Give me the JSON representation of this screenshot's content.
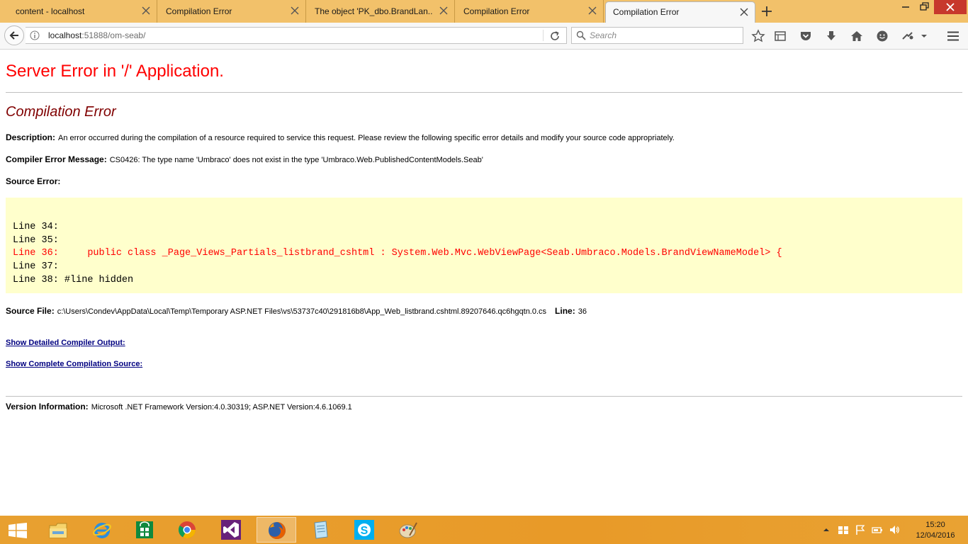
{
  "browser": {
    "tabs": [
      {
        "title": "content - localhost"
      },
      {
        "title": "Compilation Error"
      },
      {
        "title": "The object 'PK_dbo.BrandLan..."
      },
      {
        "title": "Compilation Error"
      },
      {
        "title": "Compilation Error",
        "active": true
      }
    ],
    "url_host": "localhost",
    "url_rest": ":51888/om-seab/",
    "search_placeholder": "Search"
  },
  "page": {
    "server_error_title": "Server Error in '/' Application.",
    "error_type": "Compilation Error",
    "description_label": "Description:",
    "description_text": "An error occurred during the compilation of a resource required to service this request. Please review the following specific error details and modify your source code appropriately.",
    "compiler_message_label": "Compiler Error Message:",
    "compiler_message_text": "CS0426: The type name 'Umbraco' does not exist in the type 'Umbraco.Web.PublishedContentModels.Seab'",
    "source_error_label": "Source Error:",
    "source_lines": [
      {
        "text": "Line 34:",
        "highlight": false
      },
      {
        "text": "Line 35:",
        "highlight": false
      },
      {
        "text": "Line 36:     public class _Page_Views_Partials_listbrand_cshtml : System.Web.Mvc.WebViewPage<Seab.Umbraco.Models.BrandViewNameModel> {",
        "highlight": true
      },
      {
        "text": "Line 37:",
        "highlight": false
      },
      {
        "text": "Line 38: #line hidden",
        "highlight": false
      }
    ],
    "source_file_label": "Source File:",
    "source_file_path": "c:\\Users\\Condev\\AppData\\Local\\Temp\\Temporary ASP.NET Files\\vs\\53737c40\\291816b8\\App_Web_listbrand.cshtml.89207646.qc6hgqtn.0.cs",
    "line_label": "Line:",
    "line_number": "36",
    "link_compiler_output": "Show Detailed Compiler Output:",
    "link_compilation_source": "Show Complete Compilation Source:",
    "version_label": "Version Information:",
    "version_text": "Microsoft .NET Framework Version:4.0.30319; ASP.NET Version:4.6.1069.1"
  },
  "taskbar": {
    "apps": [
      "start-icon",
      "file-explorer-icon",
      "internet-explorer-icon",
      "store-icon",
      "chrome-icon",
      "visual-studio-icon",
      "firefox-icon",
      "notepad-icon",
      "skype-icon",
      "paint-icon"
    ],
    "active_app": "firefox-icon",
    "time": "15:20",
    "date": "12/04/2016"
  },
  "colors": {
    "tabstrip": "#f2c16a",
    "error_title": "#ff0000",
    "error_type": "#800000",
    "code_background": "#ffffcc",
    "link": "#000080",
    "taskbar": "#e89a28"
  }
}
